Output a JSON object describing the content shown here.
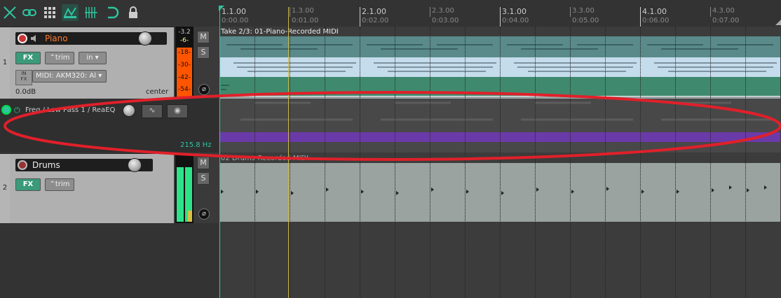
{
  "toolbar": {
    "buttons": [
      "ripple-icon",
      "link-icon",
      "grid-icon",
      "envelope-icon",
      "snap-grid-icon",
      "loop-icon",
      "lock-icon"
    ]
  },
  "tracks": [
    {
      "number": "1",
      "name": "Piano",
      "fx_label": "FX",
      "trim_label": "trim",
      "in_label": "in",
      "input_label": "MIDI: AKM320: Al",
      "in_fx_label": "IN\nFX",
      "volume": "0.0dB",
      "pan": "center",
      "meter_top": "-3.2",
      "meter_peak": "-6-",
      "meter_ticks": [
        "-18-",
        "-30-",
        "-42-",
        "-54-"
      ],
      "mute": "M",
      "solo": "S"
    },
    {
      "number": "2",
      "name": "Drums",
      "fx_label": "FX",
      "trim_label": "trim",
      "mute": "M",
      "solo": "S"
    }
  ],
  "envelope": {
    "label": "Freq / Low Pass 1 / ReaEQ",
    "value": "215.8 Hz"
  },
  "ruler": {
    "bars": [
      {
        "label": "1.1.00",
        "time": "0:00.00"
      },
      {
        "label": "1.3.00",
        "time": "0:01.00"
      },
      {
        "label": "2.1.00",
        "time": "0:02.00"
      },
      {
        "label": "2.3.00",
        "time": "0:03.00"
      },
      {
        "label": "3.1.00",
        "time": "0:04.00"
      },
      {
        "label": "3.3.00",
        "time": "0:05.00"
      },
      {
        "label": "4.1.00",
        "time": "0:06.00"
      },
      {
        "label": "4.3.00",
        "time": "0:07.00"
      }
    ]
  },
  "items": {
    "piano_take": "Take 2/3: 01-Piano-Recorded MIDI",
    "drums_take": "02 Drums-Recorded MIDI"
  },
  "colors": {
    "accent": "#2ec4a0",
    "annotation": "#e0202a",
    "playhead": "#c8b44a",
    "envelope": "#6a3aa8"
  }
}
